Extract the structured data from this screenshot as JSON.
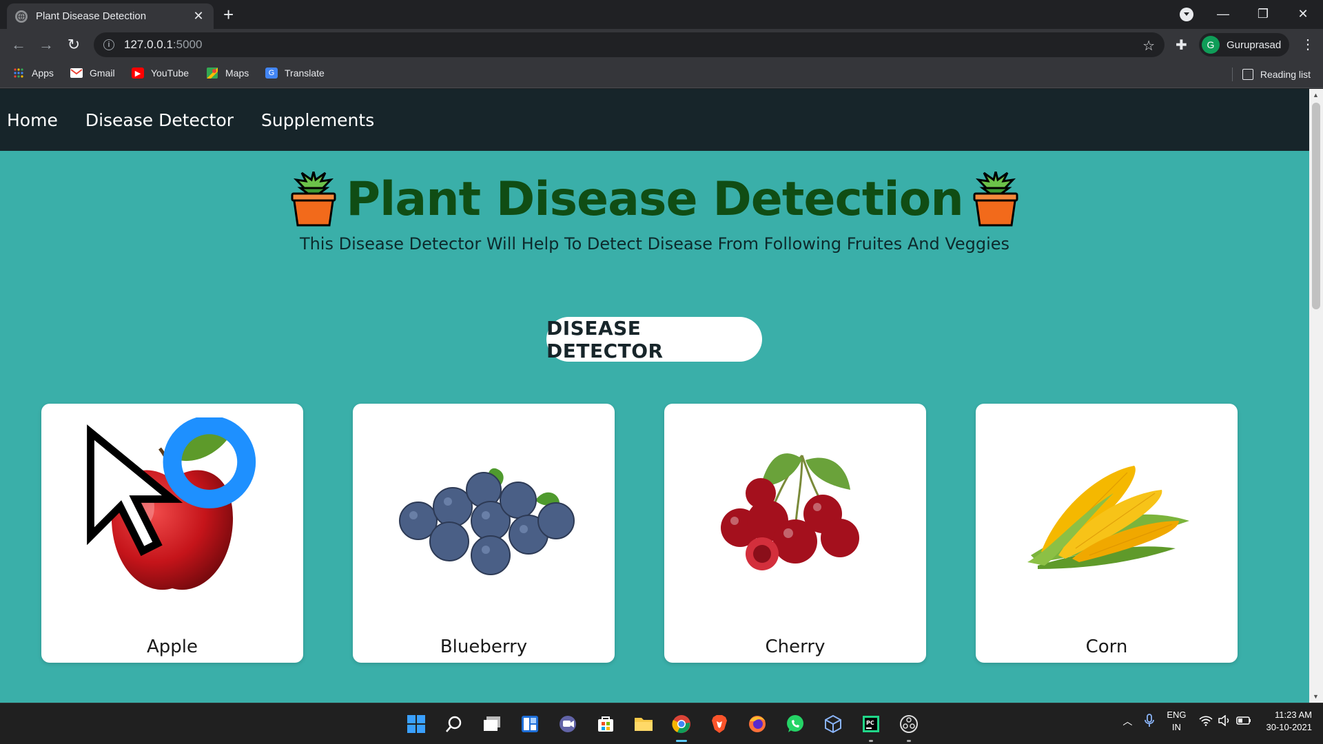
{
  "browser": {
    "tab_title": "Plant Disease Detection",
    "url_host": "127.0.0.1",
    "url_port": ":5000",
    "profile_initial": "G",
    "profile_name": "Guruprasad",
    "bookmarks": [
      "Apps",
      "Gmail",
      "YouTube",
      "Maps",
      "Translate"
    ],
    "reading_list": "Reading list"
  },
  "nav": {
    "items": [
      "Home",
      "Disease Detector",
      "Supplements"
    ]
  },
  "hero": {
    "title": "Plant Disease Detection",
    "subtitle": "This Disease Detector Will Help To Detect Disease From Following Fruites And Veggies",
    "cta": "DISEASE DETECTOR"
  },
  "cards": [
    {
      "label": "Apple",
      "icon": "apple-image"
    },
    {
      "label": "Blueberry",
      "icon": "blueberry-image"
    },
    {
      "label": "Cherry",
      "icon": "cherry-image"
    },
    {
      "label": "Corn",
      "icon": "corn-image"
    }
  ],
  "taskbar": {
    "lang_top": "ENG",
    "lang_bottom": "IN",
    "time": "11:23 AM",
    "date": "30-10-2021"
  },
  "colors": {
    "page_bg": "#3aafa9",
    "nav_bg": "#17252a",
    "title": "#104d14"
  }
}
